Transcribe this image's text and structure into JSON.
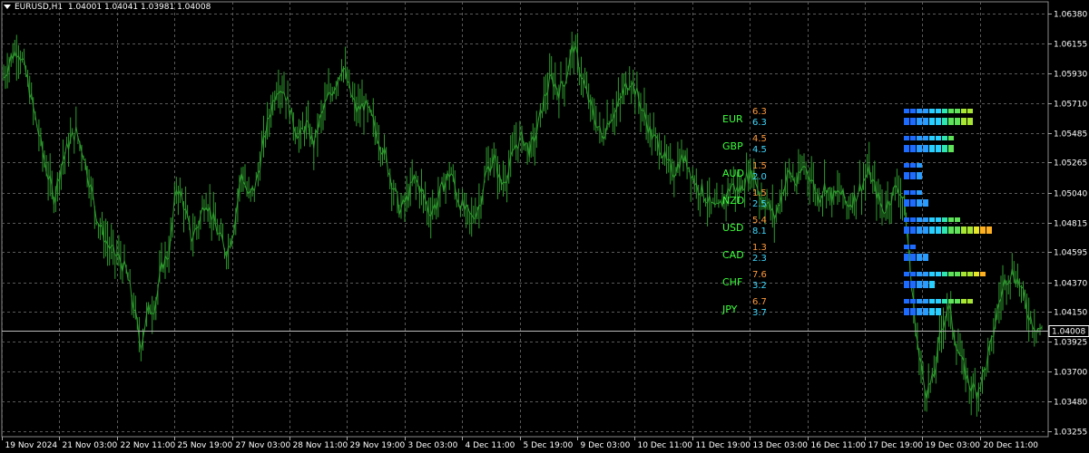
{
  "header": {
    "symbol": "EURUSD,H1",
    "ohlc": "1.04001 1.04041 1.03981 1.04008"
  },
  "colors": {
    "background": "#000000",
    "grid": "#5a5a5a",
    "price_line": "#2e9b2e",
    "axis_text": "#ffffff",
    "currency_label": "#3cff3c",
    "strength_value_top": "#ff9a3c",
    "strength_value_bottom": "#3cd8ff",
    "current_price_box": "#ffffff"
  },
  "chart_data": {
    "type": "line",
    "ylim": [
      1.0325,
      1.0662
    ],
    "y_ticks": [
      "1.06380",
      "1.06155",
      "1.05930",
      "1.05710",
      "1.05485",
      "1.05265",
      "1.05040",
      "1.04815",
      "1.04595",
      "1.04370",
      "1.04150",
      "1.03925",
      "1.03700",
      "1.03480",
      "1.03255"
    ],
    "x_ticks": [
      "19 Nov 2024",
      "21 Nov 03:00",
      "22 Nov 11:00",
      "25 Nov 19:00",
      "27 Nov 03:00",
      "28 Nov 11:00",
      "29 Nov 19:00",
      "3 Dec 03:00",
      "4 Dec 11:00",
      "5 Dec 19:00",
      "9 Dec 03:00",
      "10 Dec 11:00",
      "11 Dec 19:00",
      "13 Dec 03:00",
      "16 Dec 11:00",
      "17 Dec 19:00",
      "19 Dec 03:00",
      "20 Dec 11:00"
    ],
    "current_price": "1.04008",
    "series": [
      {
        "values": [
          1.059,
          1.0605,
          1.0612,
          1.0595,
          1.057,
          1.0545,
          1.052,
          1.05,
          1.0525,
          1.054,
          1.055,
          1.0535,
          1.051,
          1.0485,
          1.047,
          1.046,
          1.0455,
          1.0445,
          1.042,
          1.039,
          1.0415,
          1.042,
          1.045,
          1.046,
          1.051,
          1.0495,
          1.047,
          1.048,
          1.05,
          1.0485,
          1.047,
          1.046,
          1.048,
          1.052,
          1.05,
          1.051,
          1.054,
          1.0565,
          1.0585,
          1.058,
          1.056,
          1.0545,
          1.0555,
          1.054,
          1.056,
          1.0575,
          1.0585,
          1.06,
          1.058,
          1.0565,
          1.057,
          1.056,
          1.0545,
          1.053,
          1.051,
          1.049,
          1.05,
          1.0515,
          1.0505,
          1.049,
          1.0495,
          1.051,
          1.052,
          1.05,
          1.049,
          1.0485,
          1.0495,
          1.052,
          1.053,
          1.051,
          1.052,
          1.054,
          1.0545,
          1.0535,
          1.055,
          1.0575,
          1.059,
          1.058,
          1.059,
          1.0615,
          1.0595,
          1.0575,
          1.056,
          1.0545,
          1.056,
          1.0565,
          1.058,
          1.059,
          1.0575,
          1.056,
          1.0545,
          1.054,
          1.0525,
          1.052,
          1.053,
          1.0525,
          1.051,
          1.0505,
          1.0495,
          1.049,
          1.05,
          1.051,
          1.0505,
          1.0515,
          1.052,
          1.05,
          1.0495,
          1.0485,
          1.0505,
          1.052,
          1.051,
          1.0525,
          1.0515,
          1.05,
          1.051,
          1.05,
          1.0505,
          1.0495,
          1.05,
          1.051,
          1.052,
          1.0505,
          1.049,
          1.05,
          1.051,
          1.0495,
          1.043,
          1.038,
          1.0355,
          1.0365,
          1.04,
          1.042,
          1.0395,
          1.0375,
          1.036,
          1.0355,
          1.037,
          1.039,
          1.042,
          1.044,
          1.0445,
          1.0435,
          1.0415,
          1.0405,
          1.0401
        ]
      }
    ]
  },
  "strength": {
    "currencies": [
      {
        "name": "EUR",
        "v1": "6.3",
        "v2": "6.3",
        "f1": 0.63,
        "f2": 0.63
      },
      {
        "name": "GBP",
        "v1": "4.5",
        "v2": "4.5",
        "f1": 0.45,
        "f2": 0.45
      },
      {
        "name": "AUD",
        "v1": "1.5",
        "v2": "2.0",
        "f1": 0.15,
        "f2": 0.2
      },
      {
        "name": "NZD",
        "v1": "1.5",
        "v2": "2.5",
        "f1": 0.15,
        "f2": 0.25
      },
      {
        "name": "USD",
        "v1": "5.4",
        "v2": "8.1",
        "f1": 0.54,
        "f2": 0.81
      },
      {
        "name": "CAD",
        "v1": "1.3",
        "v2": "2.3",
        "f1": 0.13,
        "f2": 0.23
      },
      {
        "name": "CHF",
        "v1": "7.6",
        "v2": "3.2",
        "f1": 0.76,
        "f2": 0.32
      },
      {
        "name": "JPY",
        "v1": "6.7",
        "v2": "3.7",
        "f1": 0.67,
        "f2": 0.37
      }
    ]
  }
}
